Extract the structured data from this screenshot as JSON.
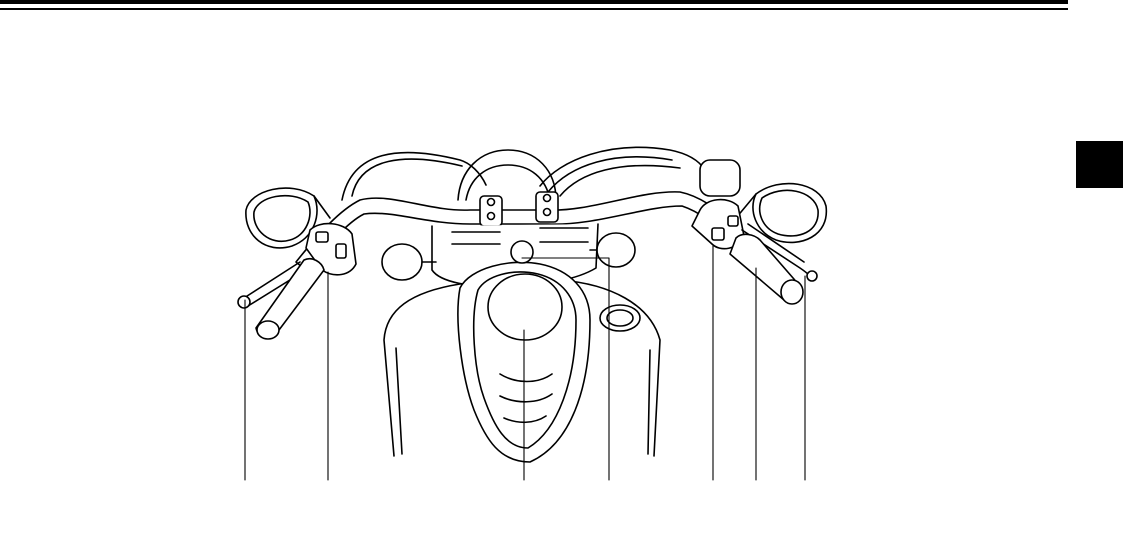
{
  "page": {
    "section_tab_label": ""
  },
  "figure": {
    "subject": "motorcycle-handlebar-controls",
    "callout_count": 7
  }
}
